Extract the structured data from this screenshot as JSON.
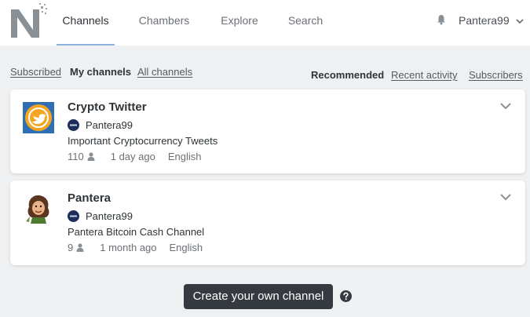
{
  "header": {
    "logo_icon": "nestedbird-n-logo",
    "tabs": [
      {
        "label": "Channels",
        "active": true
      },
      {
        "label": "Chambers",
        "active": false
      },
      {
        "label": "Explore",
        "active": false
      },
      {
        "label": "Search",
        "active": false
      }
    ],
    "notification_icon": "bell-icon",
    "username": "Pantera99"
  },
  "filters": {
    "scope": [
      {
        "label": "Subscribed",
        "active": false
      },
      {
        "label": "My channels",
        "active": true
      },
      {
        "label": "All channels",
        "active": false
      }
    ],
    "sort": [
      {
        "label": "Recommended",
        "active": true
      },
      {
        "label": "Recent activity",
        "active": false
      },
      {
        "label": "Subscribers",
        "active": false
      }
    ]
  },
  "channels": [
    {
      "title": "Crypto Twitter",
      "owner": "Pantera99",
      "description": "Important Cryptocurrency Tweets",
      "subscribers": "110",
      "updated": "1 day ago",
      "language": "English",
      "avatar_icon": "twitter-bird-avatar"
    },
    {
      "title": "Pantera",
      "owner": "Pantera99",
      "description": "Pantera Bitcoin Cash Channel",
      "subscribers": "9",
      "updated": "1 month ago",
      "language": "English",
      "avatar_icon": "cartoon-character-avatar"
    }
  ],
  "create_button": "Create your own channel",
  "colors": {
    "accent_underline": "#8ab4d8",
    "button_bg": "#343a40",
    "page_bg": "#eef0f2"
  }
}
